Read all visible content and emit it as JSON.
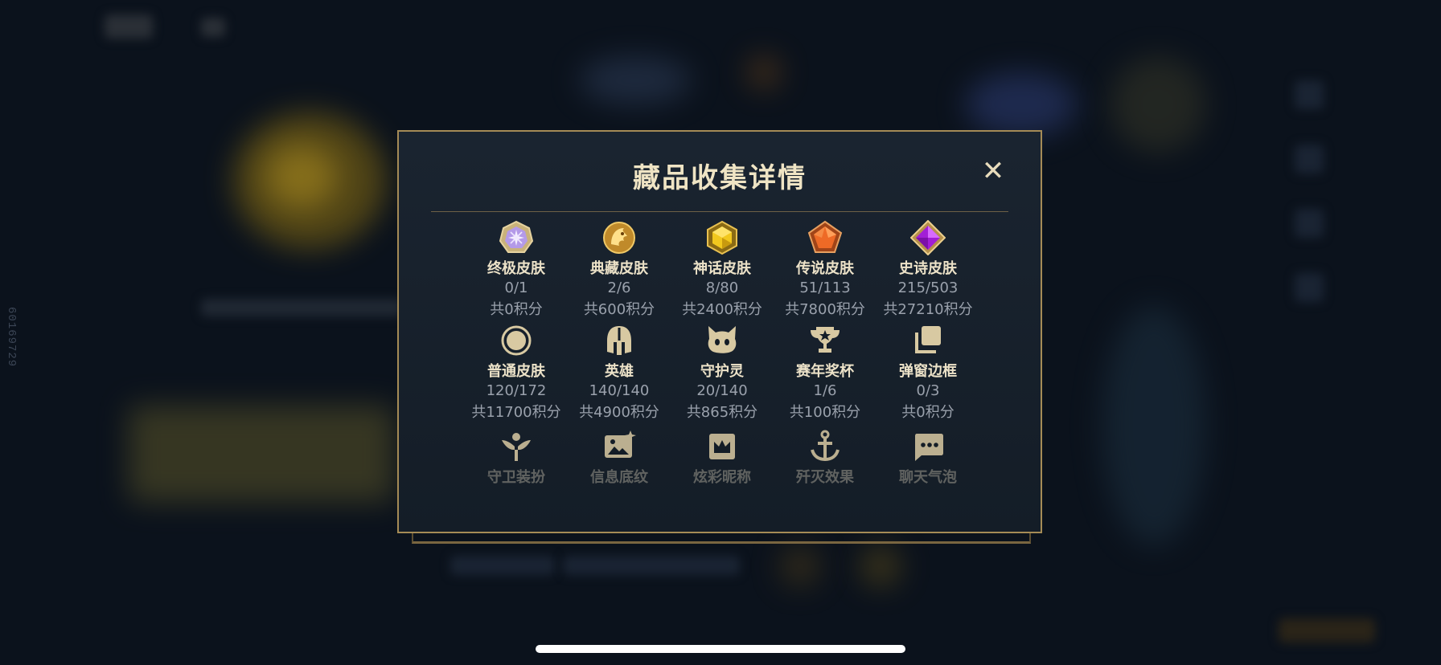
{
  "dialog": {
    "title": "藏品收集详情",
    "close_symbol": "✕"
  },
  "background": {
    "vertical_id": "60169729"
  },
  "categories": [
    {
      "name": "终极皮肤",
      "count": "0/1",
      "points": "共0积分",
      "icon": "ultimate-skin-icon"
    },
    {
      "name": "典藏皮肤",
      "count": "2/6",
      "points": "共600积分",
      "icon": "collection-skin-icon"
    },
    {
      "name": "神话皮肤",
      "count": "8/80",
      "points": "共2400积分",
      "icon": "mythic-skin-icon"
    },
    {
      "name": "传说皮肤",
      "count": "51/113",
      "points": "共7800积分",
      "icon": "legendary-skin-icon"
    },
    {
      "name": "史诗皮肤",
      "count": "215/503",
      "points": "共27210积分",
      "icon": "epic-skin-icon"
    },
    {
      "name": "普通皮肤",
      "count": "120/172",
      "points": "共11700积分",
      "icon": "normal-skin-icon"
    },
    {
      "name": "英雄",
      "count": "140/140",
      "points": "共4900积分",
      "icon": "helmet-icon"
    },
    {
      "name": "守护灵",
      "count": "20/140",
      "points": "共865积分",
      "icon": "guardian-spirit-icon"
    },
    {
      "name": "赛年奖杯",
      "count": "1/6",
      "points": "共100积分",
      "icon": "trophy-icon"
    },
    {
      "name": "弹窗边框",
      "count": "0/3",
      "points": "共0积分",
      "icon": "popup-frame-icon"
    },
    {
      "name": "守卫装扮",
      "icon": "ward-icon"
    },
    {
      "name": "信息底纹",
      "icon": "info-card-icon"
    },
    {
      "name": "炫彩昵称",
      "icon": "crown-card-icon"
    },
    {
      "name": "歼灭效果",
      "icon": "anchor-icon"
    },
    {
      "name": "聊天气泡",
      "icon": "chat-bubble-icon"
    }
  ],
  "colors": {
    "accent_gold": "#a58b56",
    "title": "#efe4c4",
    "muted": "#9aa1ac"
  }
}
